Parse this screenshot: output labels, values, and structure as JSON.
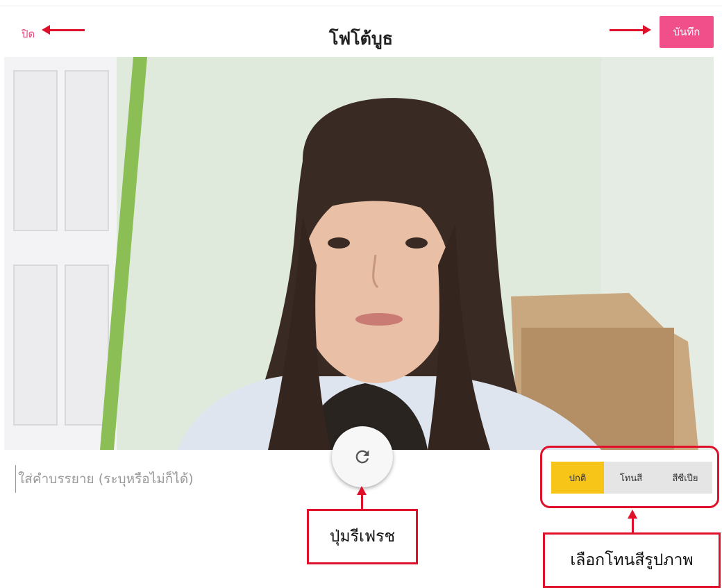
{
  "header": {
    "close_label": "ปิด",
    "title": "โฟโต้บูธ",
    "save_label": "บันทึก"
  },
  "caption": {
    "placeholder": "ใส่คำบรรยาย (ระบุหรือไม่ก็ได้)"
  },
  "filters": {
    "items": [
      {
        "label": "ปกติ",
        "active": true
      },
      {
        "label": "โทนสี",
        "active": false
      },
      {
        "label": "สีซีเปีย",
        "active": false
      }
    ]
  },
  "annotations": {
    "refresh_callout": "ปุ่มรีเฟรช",
    "filter_callout": "เลือกโทนสีรูปภาพ"
  },
  "colors": {
    "accent_pink": "#f04f8a",
    "active_filter": "#f7c418",
    "annotation_red": "#e0102a"
  },
  "icons": {
    "refresh": "refresh-icon"
  }
}
